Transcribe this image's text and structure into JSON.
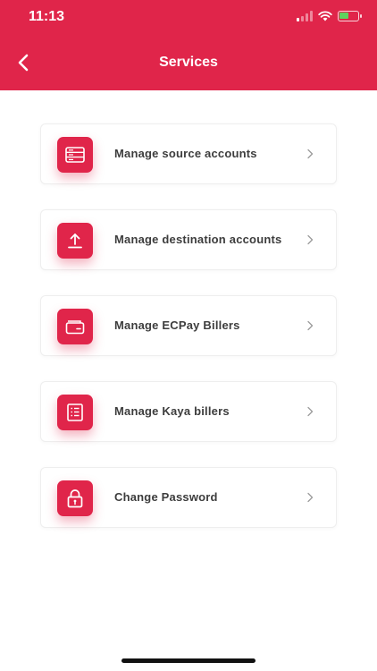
{
  "status_bar": {
    "time": "11:13"
  },
  "header": {
    "title": "Services",
    "back_icon": "chevron-left-icon"
  },
  "services": [
    {
      "label": "Manage source accounts",
      "icon": "accounts-list-icon"
    },
    {
      "label": "Manage destination accounts",
      "icon": "upload-icon"
    },
    {
      "label": "Manage ECPay Billers",
      "icon": "wallet-icon"
    },
    {
      "label": "Manage Kaya billers",
      "icon": "receipt-icon"
    },
    {
      "label": "Change Password",
      "icon": "lock-icon"
    }
  ],
  "colors": {
    "accent": "#e0254a",
    "text": "#3d3d3d",
    "chevron": "#9a9a9a"
  }
}
